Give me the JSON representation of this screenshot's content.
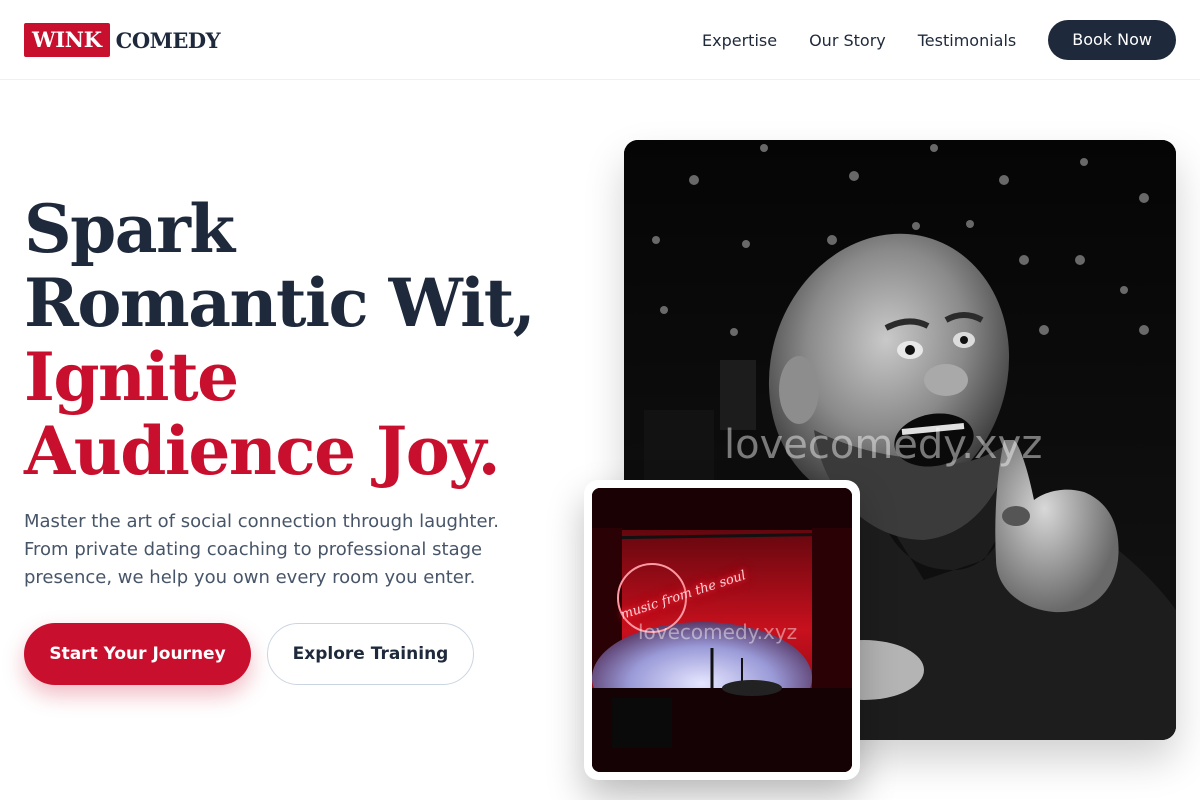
{
  "brand": {
    "logo_box": "WINK",
    "logo_word": "COMEDY"
  },
  "nav": {
    "links": [
      "Expertise",
      "Our Story",
      "Testimonials"
    ],
    "cta": "Book Now"
  },
  "hero": {
    "title_line1": "Spark Romantic Wit,",
    "title_line2": "Ignite Audience Joy.",
    "subtitle": "Master the art of social connection through laughter. From private dating coaching to professional stage presence, we help you own every room you enter.",
    "primary_cta": "Start Your Journey",
    "secondary_cta": "Explore Training"
  },
  "images": {
    "main_watermark": "lovecomedy.xyz",
    "small_watermark": "lovecomedy.xyz",
    "neon_sign": "music from the soul"
  },
  "colors": {
    "accent": "#c8102e",
    "dark": "#1e293b",
    "muted": "#475569"
  }
}
